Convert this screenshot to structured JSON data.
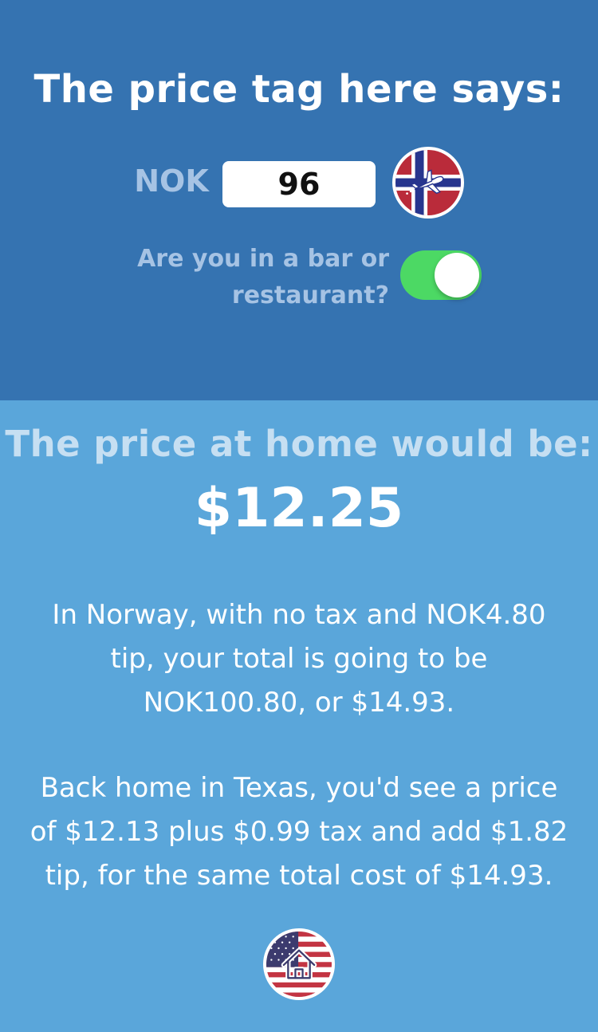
{
  "top": {
    "heading": "The price tag here says:",
    "currency_code": "NOK",
    "price_value": "96",
    "foreign_flag_icon": "norway-flag-airplane-icon",
    "toggle_label_line1": "Are you in a bar or",
    "toggle_label_line2": "restaurant?",
    "toggle_on": true,
    "colors": {
      "background": "#3573b1",
      "toggle_on": "#4cd964"
    }
  },
  "bottom": {
    "heading": "The price at home would be:",
    "home_price": "$12.25",
    "foreign_lines": [
      "In Norway, with no tax and NOK4.80",
      "tip, your total is going to be",
      "NOK100.80, or $14.93."
    ],
    "home_lines": [
      "Back home in Texas, you'd see a price",
      "of $12.13 plus $0.99 tax and add $1.82",
      "tip, for the same total cost of $14.93."
    ],
    "home_flag_icon": "usa-flag-house-icon",
    "colors": {
      "background": "#5aa6da"
    }
  }
}
